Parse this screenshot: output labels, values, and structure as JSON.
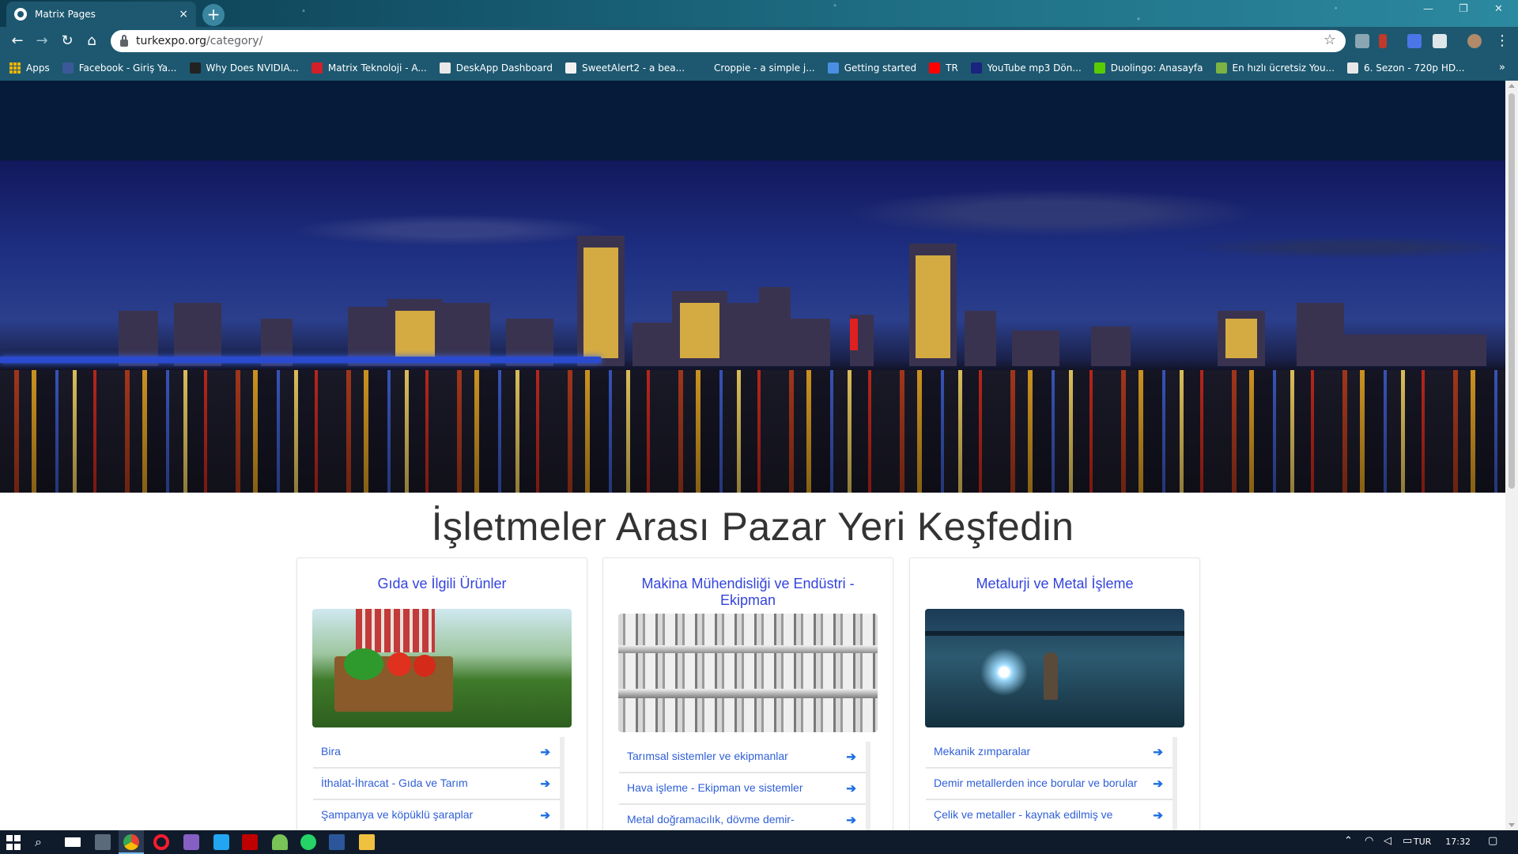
{
  "browser": {
    "tab_title": "Matrix Pages",
    "tab_close": "×",
    "new_tab": "+",
    "url_host": "turkexpo.org",
    "url_path": "/category/",
    "win_minimize": "—",
    "win_restore": "❐",
    "win_close": "✕",
    "bookmarks": [
      {
        "label": "Apps",
        "icon": "apps-grid-icon",
        "color": "#f4b400"
      },
      {
        "label": "Facebook - Giriş Ya...",
        "icon": "facebook-icon",
        "color": "#3b5998"
      },
      {
        "label": "Why Does NVIDIA...",
        "icon": "htg-icon",
        "color": "#222222"
      },
      {
        "label": "Matrix Teknoloji - A...",
        "icon": "matrix-icon",
        "color": "#d21f2b"
      },
      {
        "label": "DeskApp Dashboard",
        "icon": "globe-icon",
        "color": "#e8e8e8"
      },
      {
        "label": "SweetAlert2 - a bea...",
        "icon": "sweetalert-icon",
        "color": "#f2f2f2"
      },
      {
        "label": "Croppie - a simple j...",
        "icon": "croppie-icon",
        "color": "#1d5870"
      },
      {
        "label": "Getting started",
        "icon": "getting-started-icon",
        "color": "#4a90e2"
      },
      {
        "label": "TR",
        "icon": "youtube-icon",
        "color": "#ff0000"
      },
      {
        "label": "YouTube mp3 Dön...",
        "icon": "mp3-icon",
        "color": "#1a237e"
      },
      {
        "label": "Duolingo: Anasayfa",
        "icon": "duolingo-icon",
        "color": "#58cc02"
      },
      {
        "label": "En hızlı ücretsiz You...",
        "icon": "download-icon",
        "color": "#7cb342"
      },
      {
        "label": "6. Sezon - 720p HD...",
        "icon": "globe-icon",
        "color": "#e8e8e8"
      }
    ],
    "bookmarks_more": "»"
  },
  "page": {
    "title": "İşletmeler Arası Pazar Yeri Keşfedin",
    "cards": [
      {
        "title": "Gıda ve İlgili Ürünler",
        "items": [
          "Bira",
          "İthalat-İhracat - Gıda ve Tarım",
          "Şampanya ve köpüklü şaraplar"
        ]
      },
      {
        "title": "Makina Mühendisliği ve Endüstri - Ekipman",
        "items": [
          "Tarımsal sistemler ve ekipmanlar",
          "Hava işleme - Ekipman ve sistemler",
          "Metal doğramacılık, dövme demir-"
        ]
      },
      {
        "title": "Metalurji ve Metal İşleme",
        "items": [
          "Mekanik zımparalar",
          "Demir metallerden ince borular ve borular",
          "Çelik ve metaller - kaynak edilmiş ve"
        ]
      }
    ]
  },
  "taskbar": {
    "language": "TUR",
    "time": "17:32"
  },
  "colors": {
    "header": "#061a3a",
    "card_title": "#3344dd",
    "link": "#2f5fd6",
    "browser_chrome": "#1d5870"
  }
}
